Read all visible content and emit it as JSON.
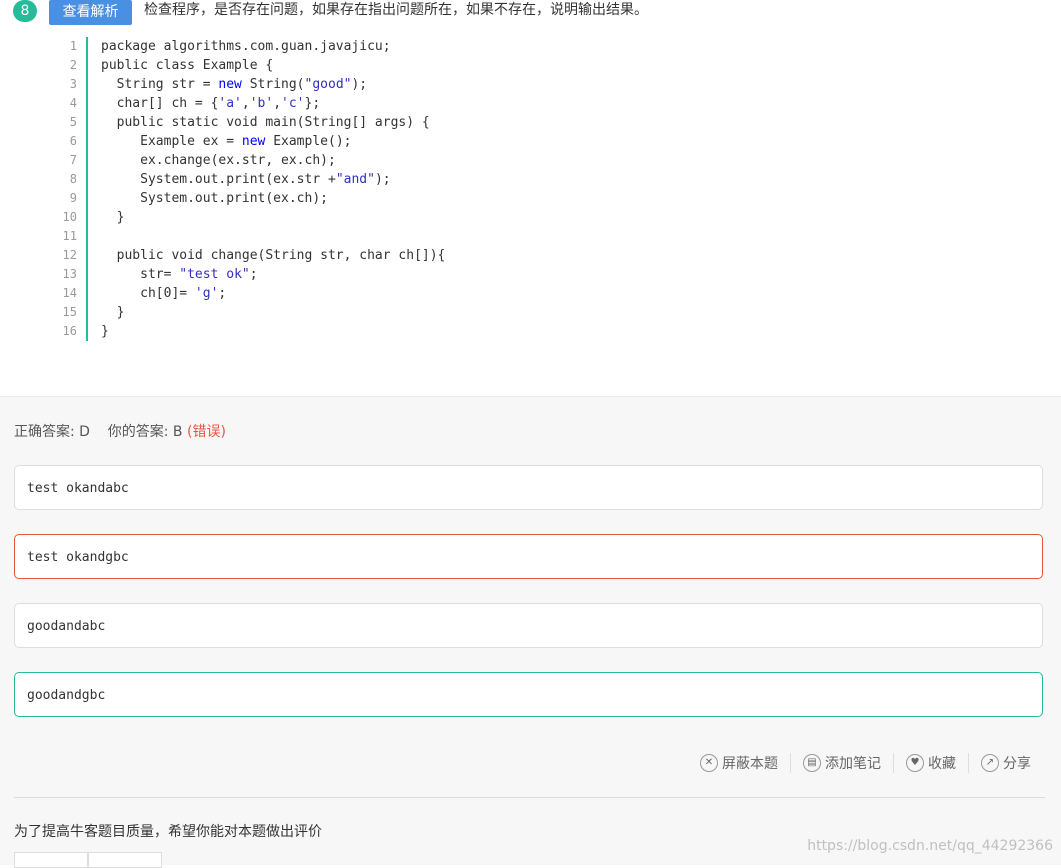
{
  "question": {
    "number": "8",
    "analysis_button": "查看解析",
    "text": "检查程序，是否存在问题，如果存在指出问题所在，如果不存在，说明输出结果。"
  },
  "code": {
    "line_numbers": [
      "1",
      "2",
      "3",
      "4",
      "5",
      "6",
      "7",
      "8",
      "9",
      "10",
      "11",
      "12",
      "13",
      "14",
      "15",
      "16"
    ]
  },
  "result": {
    "correct_label": "正确答案: D",
    "your_label": "你的答案: B",
    "wrong_label": "(错误)"
  },
  "options": [
    "test okandabc",
    "test okandgbc",
    "goodandabc",
    "goodandgbc"
  ],
  "actions": {
    "hide": "屏蔽本题",
    "note": "添加笔记",
    "favorite": "收藏",
    "share": "分享"
  },
  "rating_prompt": "为了提高牛客题目质量，希望你能对本题做出评价",
  "watermark": "https://blog.csdn.net/qq_44292366",
  "colors": {
    "accent": "#25bb9b",
    "button": "#4a90e2",
    "error": "#e8553f"
  }
}
